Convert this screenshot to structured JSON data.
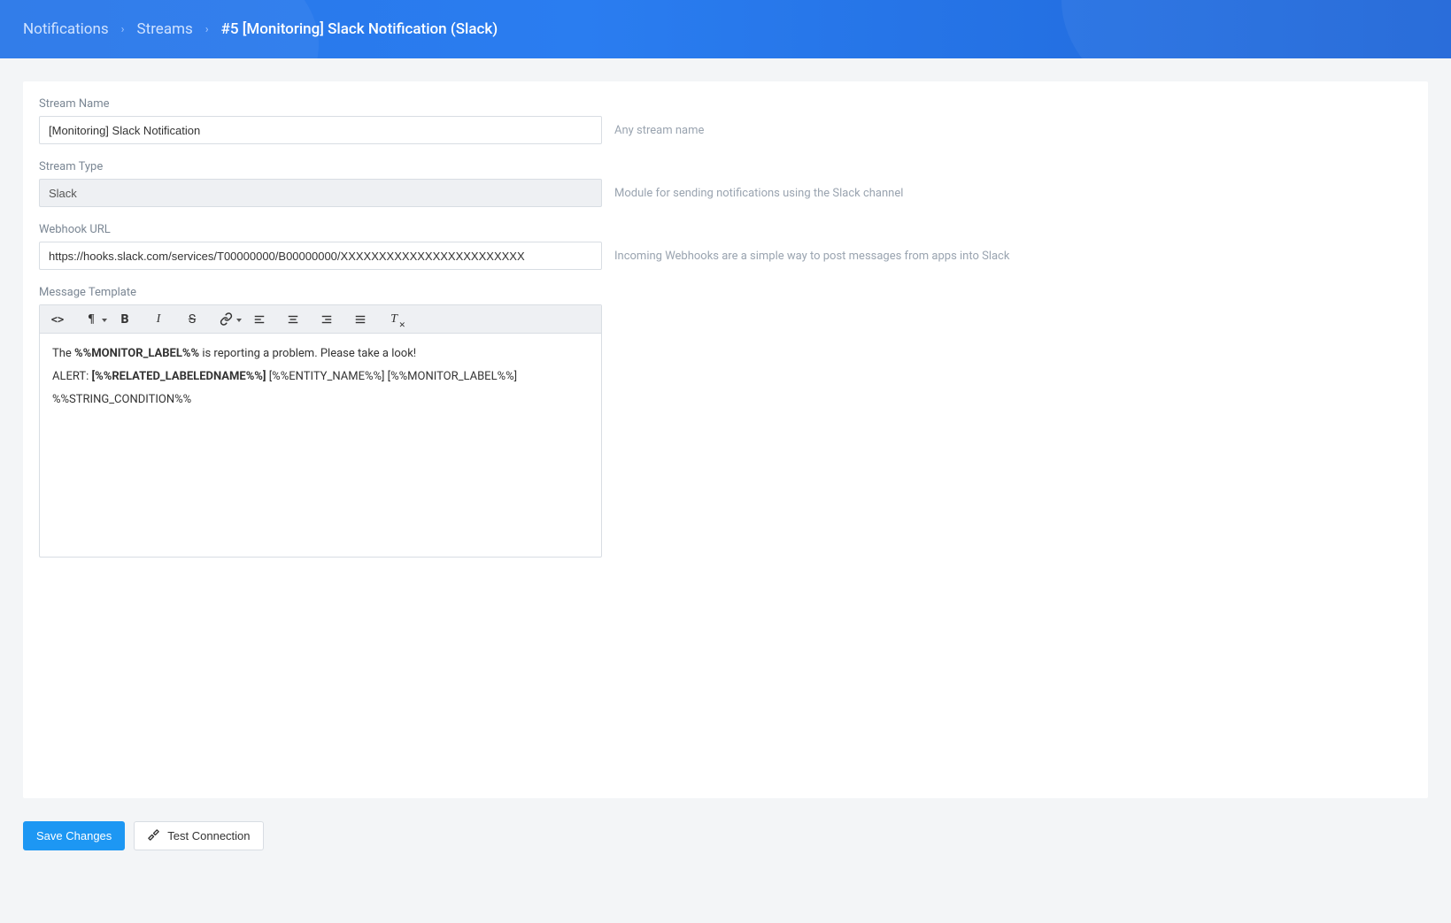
{
  "breadcrumb": {
    "notifications": "Notifications",
    "streams": "Streams",
    "current": "#5 [Monitoring] Slack Notification (Slack)"
  },
  "fields": {
    "stream_name": {
      "label": "Stream Name",
      "value": "[Monitoring] Slack Notification",
      "help": "Any stream name"
    },
    "stream_type": {
      "label": "Stream Type",
      "value": "Slack",
      "help": "Module for sending notifications using the Slack channel"
    },
    "webhook_url": {
      "label": "Webhook URL",
      "value": "https://hooks.slack.com/services/T00000000/B00000000/XXXXXXXXXXXXXXXXXXXXXXXX",
      "help": "Incoming Webhooks are a simple way to post messages from apps into Slack"
    },
    "message_template": {
      "label": "Message Template",
      "line1_pre": "The ",
      "line1_bold": "%%MONITOR_LABEL%%",
      "line1_post": " is reporting a problem. Please take a look!",
      "line2_pre": "ALERT: ",
      "line2_bold": "[%%RELATED_LABELEDNAME%%]",
      "line2_post": " [%%ENTITY_NAME%%] [%%MONITOR_LABEL%%]",
      "line3": "%%STRING_CONDITION%%"
    }
  },
  "toolbar": {
    "code": "code-view",
    "paragraph": "paragraph-format",
    "bold": "bold",
    "italic": "italic",
    "strike": "strikethrough",
    "link": "insert-link",
    "align_left": "align-left",
    "align_center": "align-center",
    "align_right": "align-right",
    "align_justify": "align-justify",
    "clear": "clear-formatting"
  },
  "buttons": {
    "save": "Save Changes",
    "test": "Test Connection"
  }
}
